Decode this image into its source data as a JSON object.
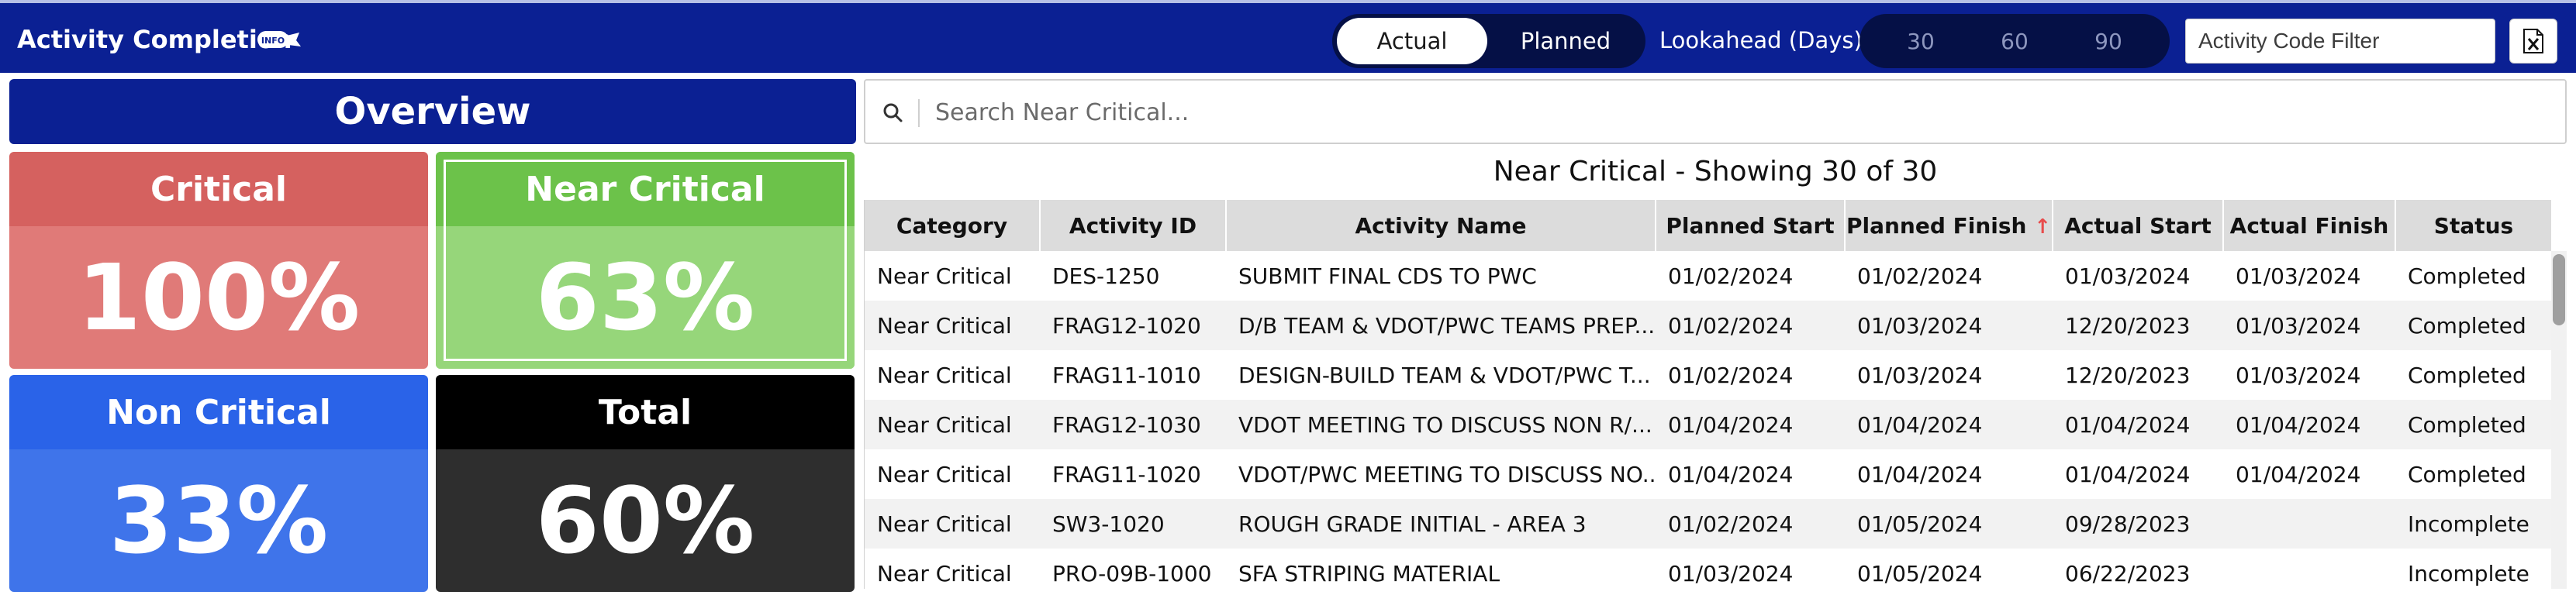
{
  "header": {
    "title": "Activity Completion",
    "info_badge": "INFO",
    "mode_toggle": {
      "options": [
        "Actual",
        "Planned"
      ],
      "selected": "Actual"
    },
    "lookahead_label": "Lookahead (Days):",
    "lookahead_options": [
      "30",
      "60",
      "90"
    ],
    "filter_placeholder": "Activity Code Filter",
    "export_icon": "excel-export-icon"
  },
  "overview": {
    "title": "Overview",
    "cards": [
      {
        "label": "Critical",
        "value": "100%",
        "color": "#d5615f"
      },
      {
        "label": "Near Critical",
        "value": "63%",
        "color": "#6cc24a",
        "selected": true
      },
      {
        "label": "Non Critical",
        "value": "33%",
        "color": "#2a63e8"
      },
      {
        "label": "Total",
        "value": "60%",
        "color": "#000000"
      }
    ]
  },
  "search": {
    "placeholder": "Search Near Critical..."
  },
  "table": {
    "caption": "Near Critical - Showing 30 of 30",
    "columns": [
      "Category",
      "Activity ID",
      "Activity Name",
      "Planned Start",
      "Planned Finish",
      "Actual Start",
      "Actual Finish",
      "Status"
    ],
    "sort_indicator": "↑",
    "rows": [
      [
        "Near Critical",
        "DES-1250",
        "SUBMIT FINAL CDS TO PWC",
        "01/02/2024",
        "01/02/2024",
        "01/03/2024",
        "01/03/2024",
        "Completed"
      ],
      [
        "Near Critical",
        "FRAG12-1020",
        "D/B TEAM & VDOT/PWC TEAMS PREP...",
        "01/02/2024",
        "01/03/2024",
        "12/20/2023",
        "01/03/2024",
        "Completed"
      ],
      [
        "Near Critical",
        "FRAG11-1010",
        "DESIGN-BUILD TEAM & VDOT/PWC T...",
        "01/02/2024",
        "01/03/2024",
        "12/20/2023",
        "01/03/2024",
        "Completed"
      ],
      [
        "Near Critical",
        "FRAG12-1030",
        "VDOT MEETING TO DISCUSS NON R/...",
        "01/04/2024",
        "01/04/2024",
        "01/04/2024",
        "01/04/2024",
        "Completed"
      ],
      [
        "Near Critical",
        "FRAG11-1020",
        "VDOT/PWC MEETING TO DISCUSS NO...",
        "01/04/2024",
        "01/04/2024",
        "01/04/2024",
        "01/04/2024",
        "Completed"
      ],
      [
        "Near Critical",
        "SW3-1020",
        "ROUGH GRADE INITIAL - AREA 3",
        "01/02/2024",
        "01/05/2024",
        "09/28/2023",
        "",
        "Incomplete"
      ],
      [
        "Near Critical",
        "PRO-09B-1000",
        "SFA STRIPING MATERIAL",
        "01/03/2024",
        "01/05/2024",
        "06/22/2023",
        "",
        "Incomplete"
      ]
    ]
  }
}
